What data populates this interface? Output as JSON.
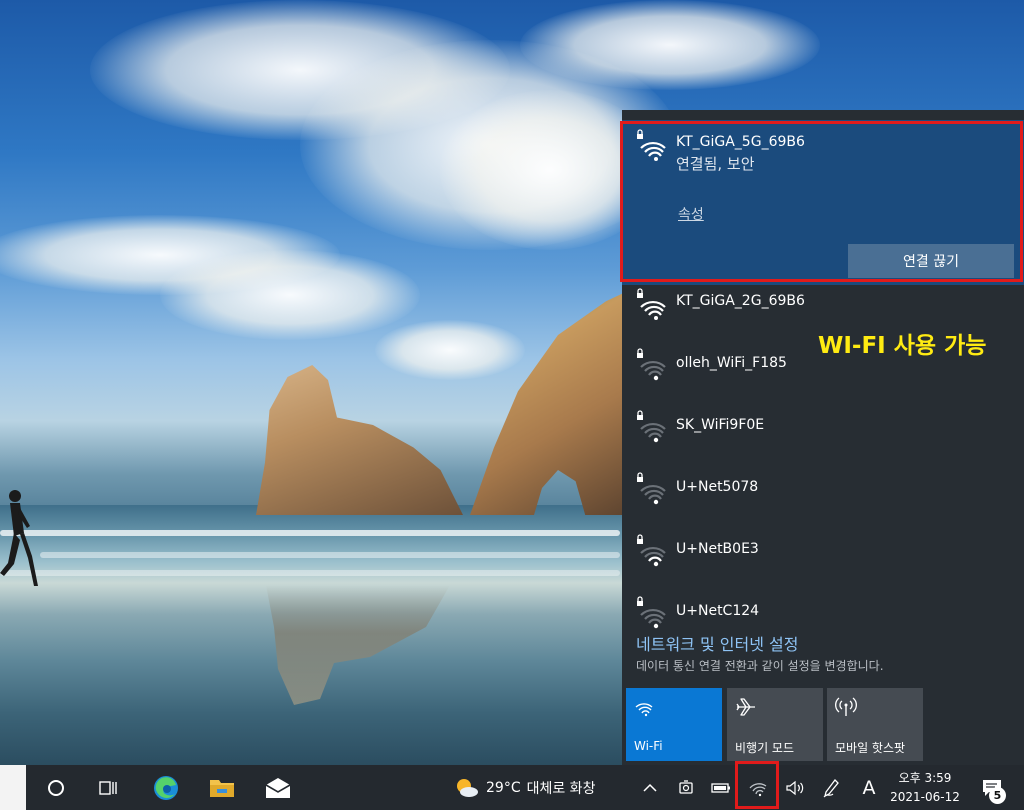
{
  "networks": [
    {
      "ssid": "KT_GiGA_5G_69B6",
      "status": "연결됨, 보안",
      "properties_label": "속성",
      "disconnect_label": "연결 끊기",
      "connected": true,
      "secured": true,
      "signal": "full"
    },
    {
      "ssid": "KT_GiGA_2G_69B6",
      "secured": true,
      "signal": "full"
    },
    {
      "ssid": "olleh_WiFi_F185",
      "secured": true,
      "signal": "weak"
    },
    {
      "ssid": "SK_WiFi9F0E",
      "secured": true,
      "signal": "weak"
    },
    {
      "ssid": "U+Net5078",
      "secured": true,
      "signal": "weak"
    },
    {
      "ssid": "U+NetB0E3",
      "secured": true,
      "signal": "medium"
    },
    {
      "ssid": "U+NetC124",
      "secured": true,
      "signal": "weak"
    }
  ],
  "annotation": "WI-FI 사용 가능",
  "settings": {
    "title": "네트워크 및 인터넷 설정",
    "subtitle": "데이터 통신 연결 전환과 같이 설정을 변경합니다."
  },
  "quick_actions": [
    {
      "label": "Wi-Fi",
      "icon": "wifi-icon",
      "active": true
    },
    {
      "label": "비행기 모드",
      "icon": "airplane-icon",
      "active": false
    },
    {
      "label": "모바일 핫스팟",
      "icon": "hotspot-icon",
      "active": false
    }
  ],
  "taskbar": {
    "weather_temp": "29°C",
    "weather_desc": "대체로 화창",
    "ime_indicator": "A",
    "time": "오후 3:59",
    "date": "2021-06-12",
    "notification_count": "5"
  },
  "colors": {
    "flyout_bg": "#272d33",
    "connected_bg": "#1b4b7d",
    "accent": "#0a78d4",
    "highlight": "#e11b1b",
    "annotation": "#ffeb12",
    "settings_link": "#8ec3f5"
  }
}
